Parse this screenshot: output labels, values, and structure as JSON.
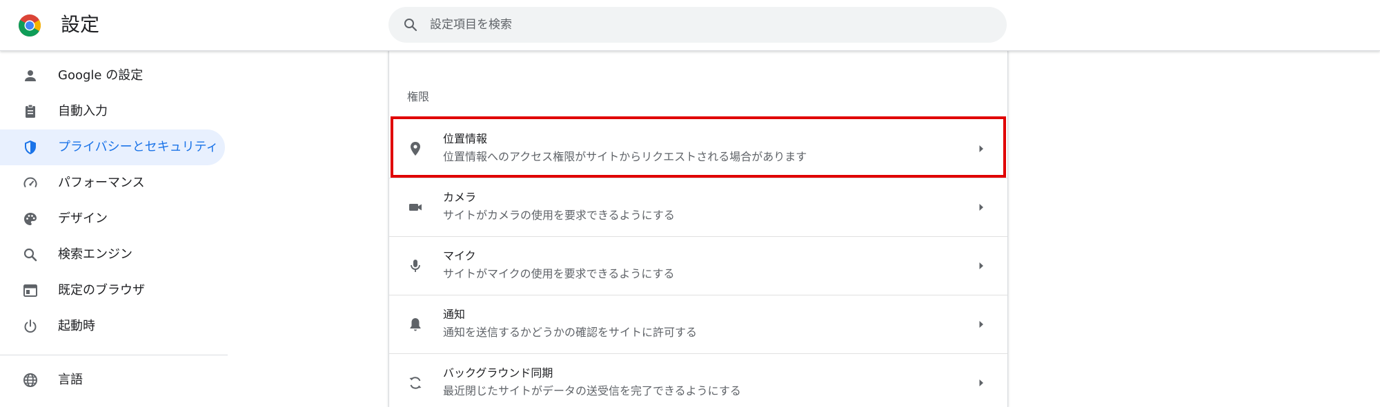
{
  "header": {
    "title": "設定",
    "search_placeholder": "設定項目を検索"
  },
  "sidebar": {
    "items": [
      {
        "label": "Google の設定",
        "icon": "person-icon",
        "active": false
      },
      {
        "label": "自動入力",
        "icon": "clipboard-icon",
        "active": false
      },
      {
        "label": "プライバシーとセキュリティ",
        "icon": "shield-icon",
        "active": true
      },
      {
        "label": "パフォーマンス",
        "icon": "speedometer-icon",
        "active": false
      },
      {
        "label": "デザイン",
        "icon": "palette-icon",
        "active": false
      },
      {
        "label": "検索エンジン",
        "icon": "search-icon",
        "active": false
      },
      {
        "label": "既定のブラウザ",
        "icon": "browser-window-icon",
        "active": false
      },
      {
        "label": "起動時",
        "icon": "power-icon",
        "active": false
      },
      {
        "label": "言語",
        "icon": "globe-icon",
        "active": false
      }
    ]
  },
  "main": {
    "section_title": "権限",
    "rows": [
      {
        "title": "位置情報",
        "subtitle": "位置情報へのアクセス権限がサイトからリクエストされる場合があります",
        "icon": "location-pin-icon",
        "highlighted": true
      },
      {
        "title": "カメラ",
        "subtitle": "サイトがカメラの使用を要求できるようにする",
        "icon": "camera-icon",
        "highlighted": false
      },
      {
        "title": "マイク",
        "subtitle": "サイトがマイクの使用を要求できるようにする",
        "icon": "microphone-icon",
        "highlighted": false
      },
      {
        "title": "通知",
        "subtitle": "通知を送信するかどうかの確認をサイトに許可する",
        "icon": "bell-icon",
        "highlighted": false
      },
      {
        "title": "バックグラウンド同期",
        "subtitle": "最近閉じたサイトがデータの送受信を完了できるようにする",
        "icon": "sync-icon",
        "highlighted": false
      }
    ]
  },
  "colors": {
    "accent": "#1a73e8",
    "active_bg": "#e8f0fe",
    "highlight_border": "#e00000",
    "icon_gray": "#5f6368"
  }
}
